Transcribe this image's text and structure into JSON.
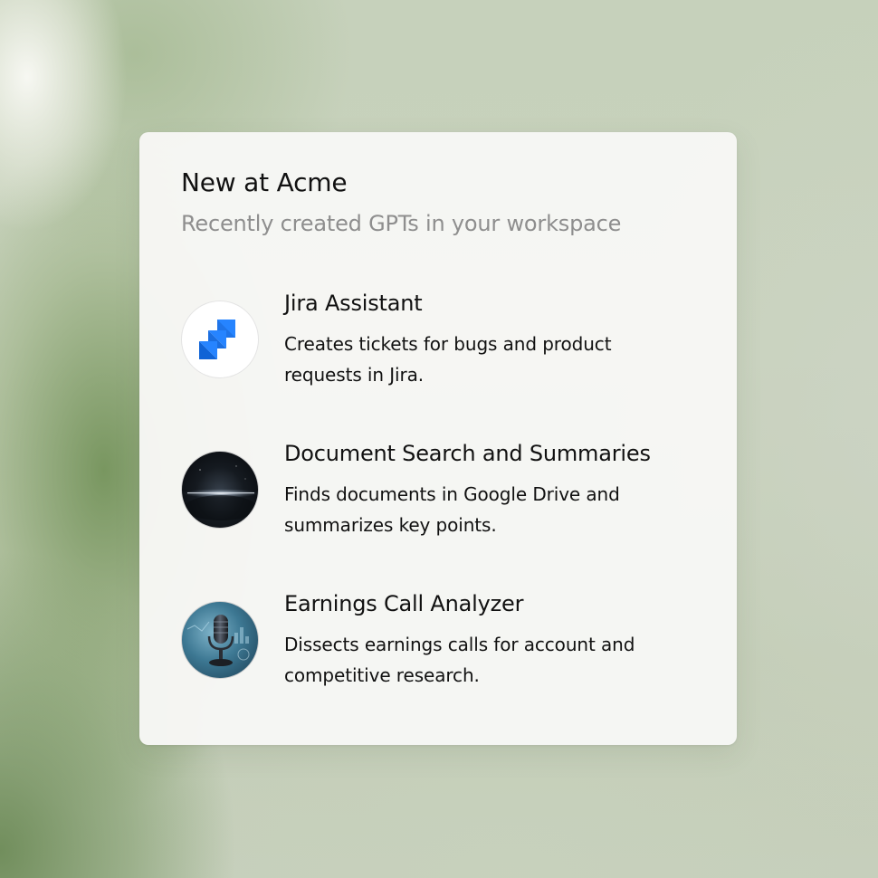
{
  "card": {
    "title": "New at Acme",
    "subtitle": "Recently created GPTs in your workspace"
  },
  "gpts": [
    {
      "name": "Jira Assistant",
      "description": "Creates tickets for bugs and product requests in Jira.",
      "icon": "jira-logo-icon",
      "icon_color": "#2684FF"
    },
    {
      "name": "Document Search and Summaries",
      "description": "Finds documents in Google Drive and summarizes key points.",
      "icon": "dark-horizon-glow-icon",
      "icon_color": "#0b0f14"
    },
    {
      "name": "Earnings Call Analyzer",
      "description": "Dissects earnings calls for account and competitive research.",
      "icon": "microphone-icon",
      "icon_color": "#3d7893"
    }
  ],
  "colors": {
    "card_background": "#f7f7f5",
    "title_text": "#111111",
    "subtitle_text": "#8e8e8e",
    "page_background": "#c6d1bb"
  }
}
